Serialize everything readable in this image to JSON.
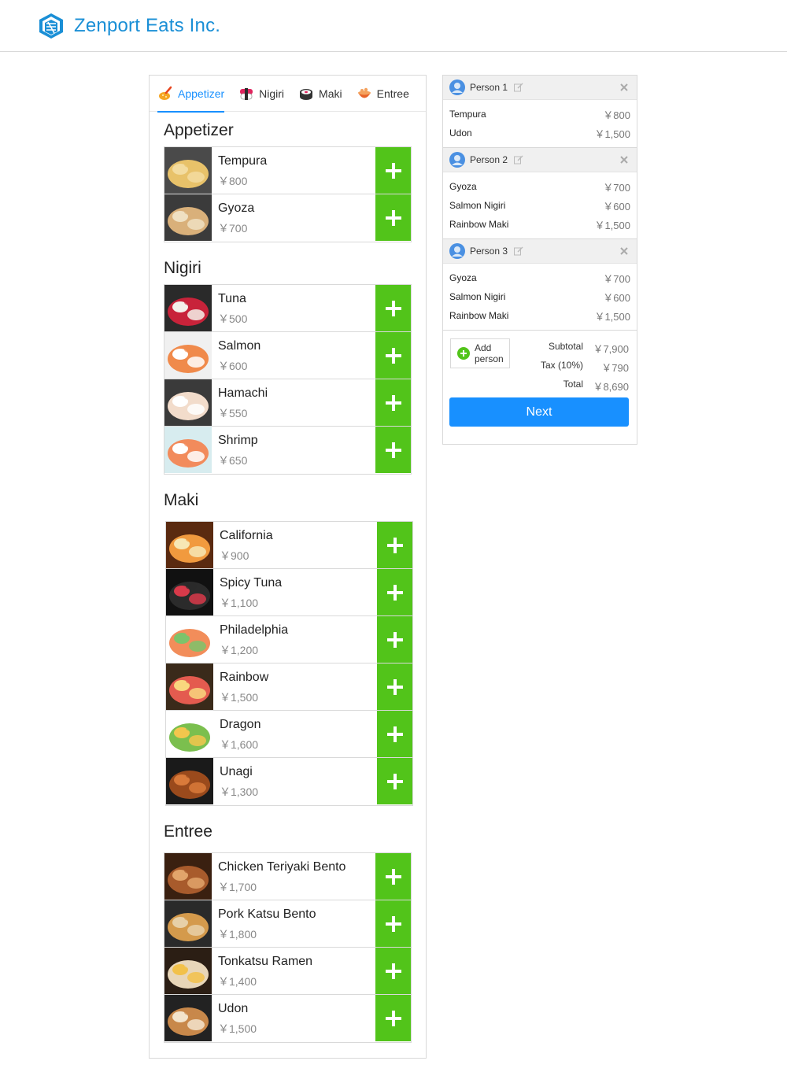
{
  "header": {
    "brand": "Zenport Eats Inc."
  },
  "tabs": [
    {
      "label": "Appetizer",
      "active": true
    },
    {
      "label": "Nigiri",
      "active": false
    },
    {
      "label": "Maki",
      "active": false
    },
    {
      "label": "Entree",
      "active": false
    }
  ],
  "menu": {
    "appetizer": {
      "title": "Appetizer",
      "items": [
        {
          "name": "Tempura",
          "price": "￥800"
        },
        {
          "name": "Gyoza",
          "price": "￥700"
        }
      ]
    },
    "nigiri": {
      "title": "Nigiri",
      "items": [
        {
          "name": "Tuna",
          "price": "￥500"
        },
        {
          "name": "Salmon",
          "price": "￥600"
        },
        {
          "name": "Hamachi",
          "price": "￥550"
        },
        {
          "name": "Shrimp",
          "price": "￥650"
        }
      ]
    },
    "maki": {
      "title": "Maki",
      "items": [
        {
          "name": "California",
          "price": "￥900"
        },
        {
          "name": "Spicy Tuna",
          "price": "￥1,100"
        },
        {
          "name": "Philadelphia",
          "price": "￥1,200"
        },
        {
          "name": "Rainbow",
          "price": "￥1,500"
        },
        {
          "name": "Dragon",
          "price": "￥1,600"
        },
        {
          "name": "Unagi",
          "price": "￥1,300"
        }
      ]
    },
    "entree": {
      "title": "Entree",
      "items": [
        {
          "name": "Chicken Teriyaki Bento",
          "price": "￥1,700"
        },
        {
          "name": "Pork Katsu Bento",
          "price": "￥1,800"
        },
        {
          "name": "Tonkatsu Ramen",
          "price": "￥1,400"
        },
        {
          "name": "Udon",
          "price": "￥1,500"
        }
      ]
    }
  },
  "order": {
    "persons": [
      {
        "name": "Person 1",
        "lines": [
          {
            "item": "Tempura",
            "price": "￥800"
          },
          {
            "item": "Udon",
            "price": "￥1,500"
          }
        ]
      },
      {
        "name": "Person 2",
        "lines": [
          {
            "item": "Gyoza",
            "price": "￥700"
          },
          {
            "item": "Salmon Nigiri",
            "price": "￥600"
          },
          {
            "item": "Rainbow Maki",
            "price": "￥1,500"
          }
        ]
      },
      {
        "name": "Person 3",
        "lines": [
          {
            "item": "Gyoza",
            "price": "￥700"
          },
          {
            "item": "Salmon Nigiri",
            "price": "￥600"
          },
          {
            "item": "Rainbow Maki",
            "price": "￥1,500"
          }
        ]
      }
    ],
    "add_person_line1": "Add",
    "add_person_line2": "person",
    "subtotal_label": "Subtotal",
    "subtotal_value": "￥7,900",
    "tax_label": "Tax (10%)",
    "tax_value": "￥790",
    "total_label": "Total",
    "total_value": "￥8,690",
    "next_label": "Next"
  },
  "colors": {
    "accent": "#1890ff",
    "add": "#52c41a",
    "brand": "#1a8fd6"
  }
}
